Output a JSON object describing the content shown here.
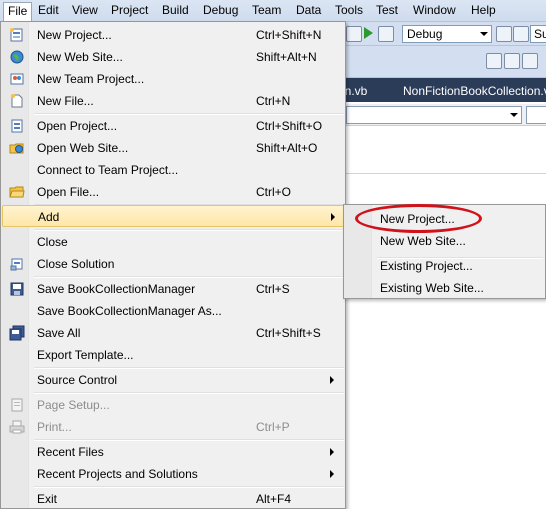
{
  "menubar": {
    "items": [
      "File",
      "Edit",
      "View",
      "Project",
      "Build",
      "Debug",
      "Team",
      "Data",
      "Tools",
      "Test",
      "Window",
      "Help"
    ]
  },
  "toolbar": {
    "config_value": "Debug",
    "platform_value": "Su"
  },
  "tabs": [
    "on.vb",
    "NonFictionBookCollection.v"
  ],
  "file_menu": {
    "items": [
      {
        "label": "New Project...",
        "shortcut": "Ctrl+Shift+N",
        "icon": "new-project-icon"
      },
      {
        "label": "New Web Site...",
        "shortcut": "Shift+Alt+N",
        "icon": "globe-icon"
      },
      {
        "label": "New Team Project...",
        "shortcut": "",
        "icon": "team-project-icon"
      },
      {
        "label": "New File...",
        "shortcut": "Ctrl+N",
        "icon": "new-file-icon"
      },
      {
        "label": "Open Project...",
        "shortcut": "Ctrl+Shift+O",
        "icon": "open-project-icon"
      },
      {
        "label": "Open Web Site...",
        "shortcut": "Shift+Alt+O",
        "icon": "open-web-site-icon"
      },
      {
        "label": "Connect to Team Project...",
        "shortcut": "",
        "icon": ""
      },
      {
        "label": "Open File...",
        "shortcut": "Ctrl+O",
        "icon": "folder-icon"
      },
      {
        "label": "Add",
        "shortcut": "",
        "icon": "",
        "submenu": true
      },
      {
        "label": "Close",
        "shortcut": "",
        "icon": ""
      },
      {
        "label": "Close Solution",
        "shortcut": "",
        "icon": "close-solution-icon"
      },
      {
        "label": "Save BookCollectionManager",
        "shortcut": "Ctrl+S",
        "icon": "save-icon"
      },
      {
        "label": "Save BookCollectionManager As...",
        "shortcut": "",
        "icon": ""
      },
      {
        "label": "Save All",
        "shortcut": "Ctrl+Shift+S",
        "icon": "save-all-icon"
      },
      {
        "label": "Export Template...",
        "shortcut": "",
        "icon": ""
      },
      {
        "label": "Source Control",
        "shortcut": "",
        "icon": "",
        "submenu": true
      },
      {
        "label": "Page Setup...",
        "shortcut": "",
        "icon": "page-setup-icon",
        "disabled": true
      },
      {
        "label": "Print...",
        "shortcut": "Ctrl+P",
        "icon": "print-icon",
        "disabled": true
      },
      {
        "label": "Recent Files",
        "shortcut": "",
        "icon": "",
        "submenu": true
      },
      {
        "label": "Recent Projects and Solutions",
        "shortcut": "",
        "icon": "",
        "submenu": true
      },
      {
        "label": "Exit",
        "shortcut": "Alt+F4",
        "icon": ""
      }
    ]
  },
  "add_submenu": {
    "items": [
      "New Project...",
      "New Web Site...",
      "Existing Project...",
      "Existing Web Site..."
    ]
  },
  "colors": {
    "highlight": "#fee6a6",
    "annotation": "#d0121a"
  }
}
